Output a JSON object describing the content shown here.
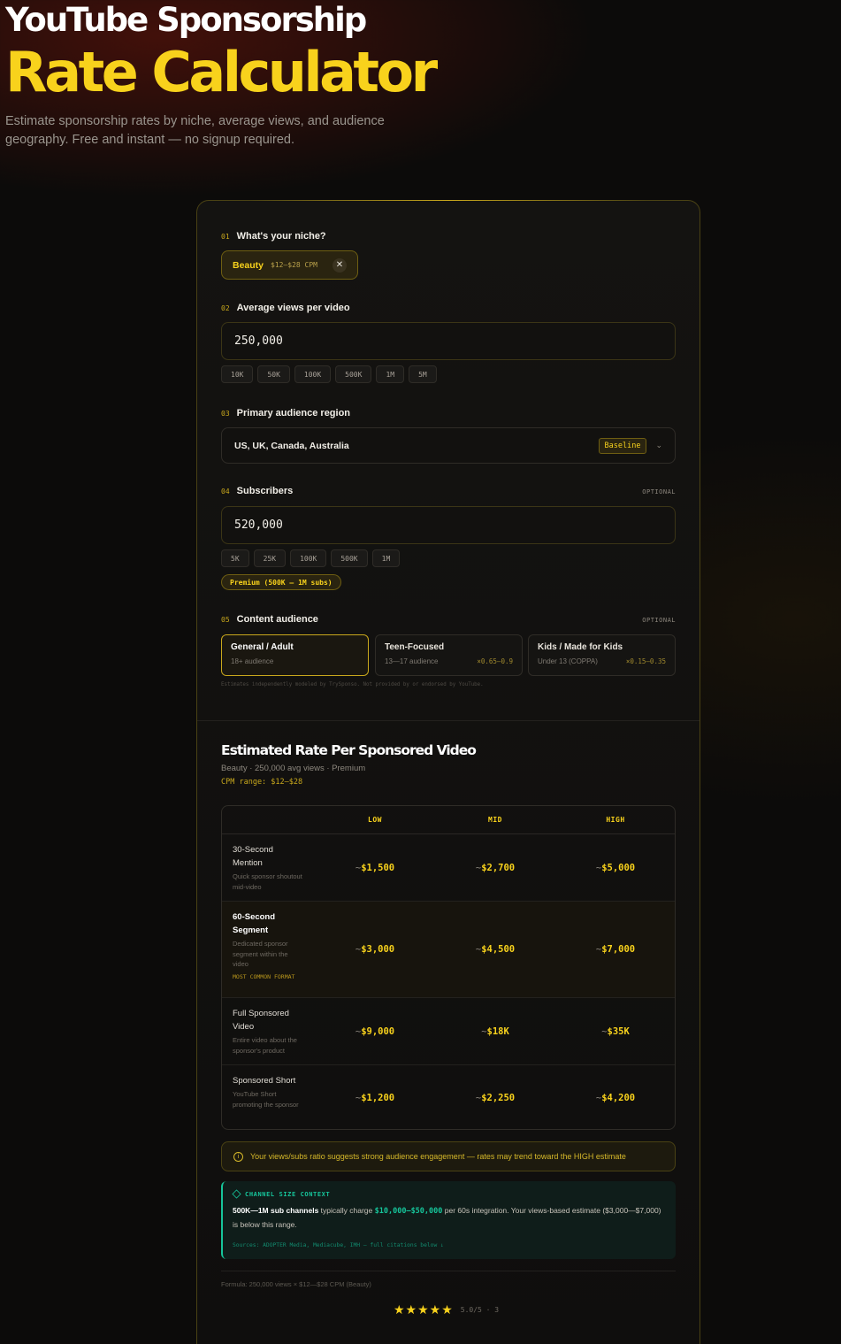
{
  "hero": {
    "title_line1": "YouTube Sponsorship",
    "title_line2": "Rate Calculator",
    "subtitle": "Estimate sponsorship rates by niche, average views, and audience geography. Free and instant — no signup required."
  },
  "form": {
    "niche": {
      "num": "01",
      "label": "What's your niche?",
      "selected": "Beauty",
      "cpm": "$12–$28 CPM",
      "clear_icon": "close-icon"
    },
    "views": {
      "num": "02",
      "label": "Average views per video",
      "value": "250,000",
      "presets": [
        "10K",
        "50K",
        "100K",
        "500K",
        "1M",
        "5M"
      ]
    },
    "region": {
      "num": "03",
      "label": "Primary audience region",
      "value": "US, UK, Canada, Australia",
      "badge": "Baseline",
      "chevron_icon": "chevron-down-icon"
    },
    "subscribers": {
      "num": "04",
      "label": "Subscribers",
      "optional": "OPTIONAL",
      "value": "520,000",
      "presets": [
        "5K",
        "25K",
        "100K",
        "500K",
        "1M"
      ],
      "tier": "Premium (500K – 1M subs)"
    },
    "audience": {
      "num": "05",
      "label": "Content audience",
      "optional": "OPTIONAL",
      "options": [
        {
          "title": "General / Adult",
          "sub": "18+ audience",
          "mult": "",
          "selected": true
        },
        {
          "title": "Teen-Focused",
          "sub": "13—17 audience",
          "mult": "×0.65–0.9",
          "selected": false
        },
        {
          "title": "Kids / Made for Kids",
          "sub": "Under 13 (COPPA)",
          "mult": "×0.15–0.35",
          "selected": false
        }
      ],
      "disclaimer": "Estimates independently modeled by TrySponso. Not provided by or endorsed by YouTube."
    }
  },
  "results": {
    "title": "Estimated Rate Per Sponsored Video",
    "subtitle": "Beauty · 250,000 avg views · Premium",
    "cpm_range": "CPM range: $12–$28",
    "columns": [
      "LOW",
      "MID",
      "HIGH"
    ],
    "rows": [
      {
        "name": "30-Second Mention",
        "desc": "Quick sponsor shoutout mid-video",
        "tag": "",
        "low": "$1,500",
        "mid": "$2,700",
        "high": "$5,000",
        "highlight": false
      },
      {
        "name": "60-Second Segment",
        "desc": "Dedicated sponsor segment within the video",
        "tag": "MOST COMMON FORMAT",
        "low": "$3,000",
        "mid": "$4,500",
        "high": "$7,000",
        "highlight": true
      },
      {
        "name": "Full Sponsored Video",
        "desc": "Entire video about the sponsor's product",
        "tag": "",
        "low": "$9,000",
        "mid": "$18K",
        "high": "$35K",
        "highlight": false
      },
      {
        "name": "Sponsored Short",
        "desc": "YouTube Short promoting the sponsor",
        "tag": "",
        "low": "$1,200",
        "mid": "$2,250",
        "high": "$4,200",
        "highlight": false
      }
    ],
    "notice": "Your views/subs ratio suggests strong audience engagement — rates may trend toward the HIGH estimate",
    "notice_icon": "info-icon",
    "context": {
      "heading": "CHANNEL SIZE CONTEXT",
      "icon": "layers-icon",
      "bold": "500K—1M sub channels",
      "text1": " typically charge ",
      "range": "$10,000–$50,000",
      "text2": " per 60s integration. Your views-based estimate ($3,000—$7,000) is below this range.",
      "sources": "Sources: ADOPTER Media, Mediacube, IMH — full citations below ↓"
    },
    "formula": "Formula: 250,000 views × $12—$28 CPM (Beauty)",
    "rating": {
      "stars": "★★★★★",
      "value": "5.0/5 · 3"
    }
  }
}
